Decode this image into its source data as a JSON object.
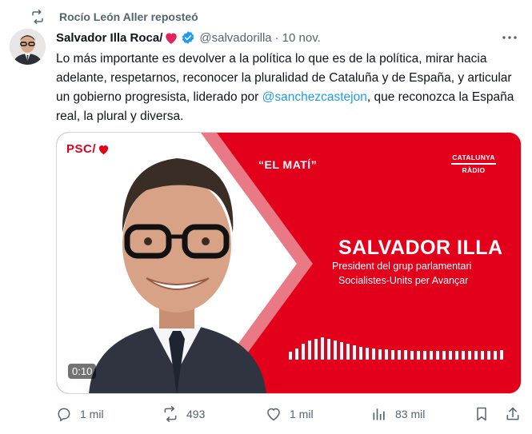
{
  "repost": {
    "icon": "repost-icon",
    "text": "Rocío León Aller reposteó"
  },
  "tweet": {
    "author_name": "Salvador Illa Roca/",
    "heart_icon": "red-heart-icon",
    "verified_icon": "verified-badge-icon",
    "handle": "@salvadorilla",
    "separator": "·",
    "date": "10 nov.",
    "text_before": "Lo más importante es devolver a la política lo que es de la política, mirar hacia adelante, respetarnos, reconocer la pluralidad de Cataluña y de España, y articular un gobierno progresista, liderado por ",
    "mention": "@sanchezcastejon",
    "text_after": ", que reconozca la España real, la plural y diversa."
  },
  "media": {
    "party_logo": "PSC/",
    "show_title": "“EL MATÍ”",
    "radio_logo_line1": "CATALUNYA",
    "radio_logo_line2": "RÀDIO",
    "speaker_name": "SALVADOR ILLA",
    "speaker_role_line1": "President del grup parlamentari",
    "speaker_role_line2": "Socialistes-Units per Avançar",
    "duration": "0:10",
    "colors": {
      "brand_red": "#e3001b",
      "white": "#ffffff"
    }
  },
  "actions": {
    "reply_count": "1 mil",
    "repost_count": "493",
    "like_count": "1 mil",
    "views_count": "83 mil"
  },
  "colors": {
    "text_primary": "#0f1419",
    "text_secondary": "#536471",
    "link": "#1d9bf0",
    "verified": "#1d9bf0",
    "heart": "#e0245e"
  }
}
